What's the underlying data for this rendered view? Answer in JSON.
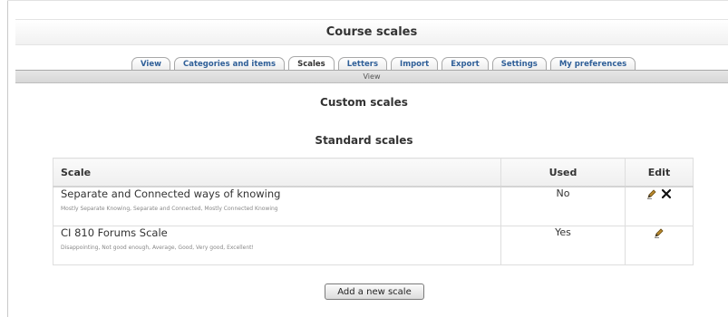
{
  "page_title": "Course scales",
  "tabs": [
    {
      "label": "View",
      "active": false
    },
    {
      "label": "Categories and items",
      "active": false
    },
    {
      "label": "Scales",
      "active": true
    },
    {
      "label": "Letters",
      "active": false
    },
    {
      "label": "Import",
      "active": false
    },
    {
      "label": "Export",
      "active": false
    },
    {
      "label": "Settings",
      "active": false
    },
    {
      "label": "My preferences",
      "active": false
    }
  ],
  "subtab": {
    "label": "View"
  },
  "sections": {
    "custom_heading": "Custom scales",
    "standard_heading": "Standard scales"
  },
  "table": {
    "headers": {
      "scale": "Scale",
      "used": "Used",
      "edit": "Edit"
    },
    "rows": [
      {
        "name": "Separate and Connected ways of knowing",
        "description": "Mostly Separate Knowing, Separate and Connected, Mostly Connected Knowing",
        "used": "No",
        "actions": [
          "edit-icon",
          "delete-icon"
        ]
      },
      {
        "name": "CI 810 Forums Scale",
        "description": "Disappointing, Not good enough, Average, Good, Very good, Excellent!",
        "used": "Yes",
        "actions": [
          "edit-icon"
        ]
      }
    ]
  },
  "add_button": {
    "label": "Add a new scale"
  },
  "colors": {
    "link_blue": "#2f5f98",
    "text": "#333333"
  }
}
